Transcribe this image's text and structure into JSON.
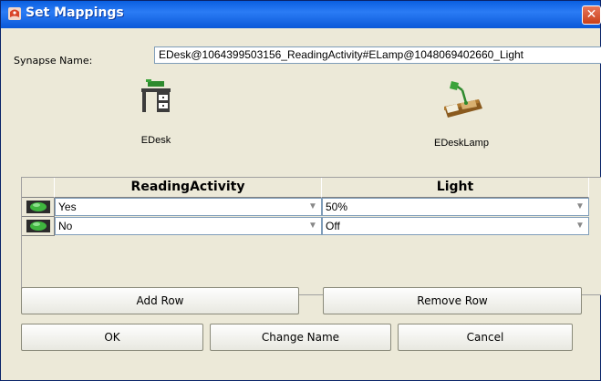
{
  "window": {
    "title": "Set Mappings",
    "close_glyph": "✕"
  },
  "synapse": {
    "label": "Synapse Name:",
    "value": "EDesk@1064399503156_ReadingActivity#ELamp@1048069402660_Light"
  },
  "objects": {
    "left": {
      "name": "EDesk",
      "icon": "desk-icon"
    },
    "right": {
      "name": "EDeskLamp",
      "icon": "desk-lamp-icon"
    }
  },
  "table": {
    "columns": [
      "ReadingActivity",
      "Light"
    ],
    "rows": [
      {
        "activity": "Yes",
        "light": "50%"
      },
      {
        "activity": "No",
        "light": "Off"
      }
    ]
  },
  "buttons": {
    "add_row": "Add Row",
    "remove_row": "Remove Row",
    "ok": "OK",
    "change_name": "Change Name",
    "cancel": "Cancel"
  },
  "colors": {
    "titlebar": "#0a5fe0",
    "close": "#c9401a",
    "dialog_bg": "#ece9d8"
  }
}
